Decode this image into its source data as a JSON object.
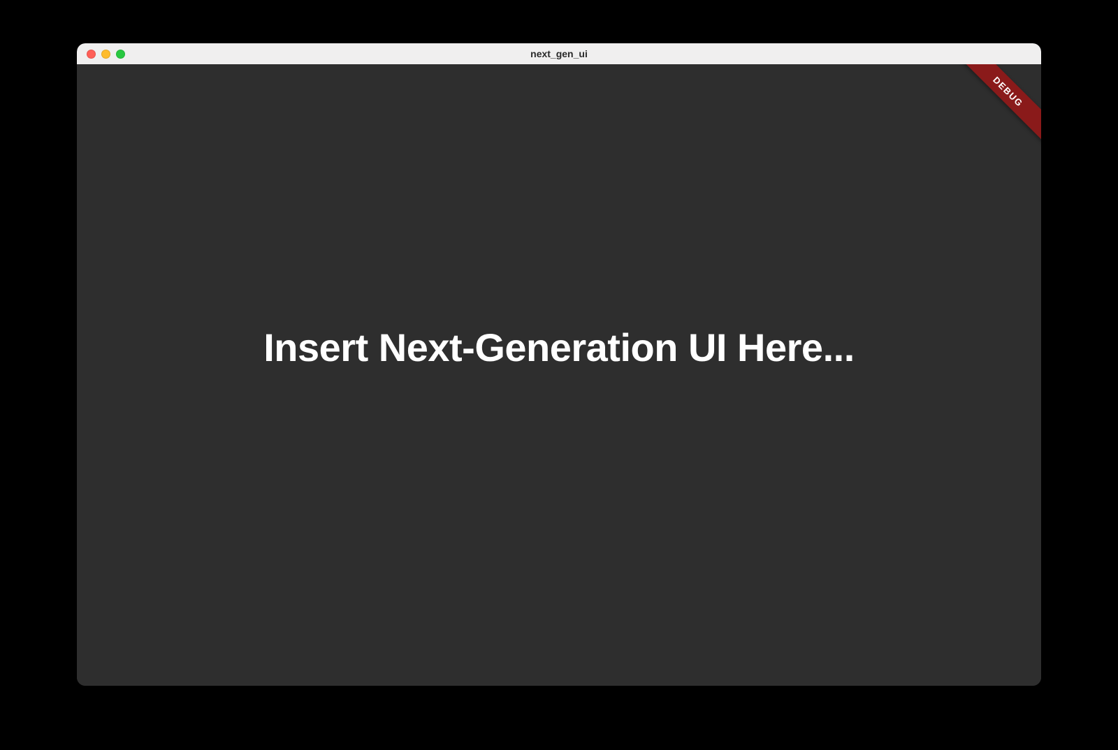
{
  "window": {
    "title": "next_gen_ui",
    "background": "#2e2e2e"
  },
  "traffic_lights": {
    "close_color": "#ff5f57",
    "minimize_color": "#febc2e",
    "maximize_color": "#28c840"
  },
  "content": {
    "placeholder_text": "Insert Next-Generation UI Here..."
  },
  "banner": {
    "label": "DEBUG",
    "color": "#8a1a1a"
  }
}
